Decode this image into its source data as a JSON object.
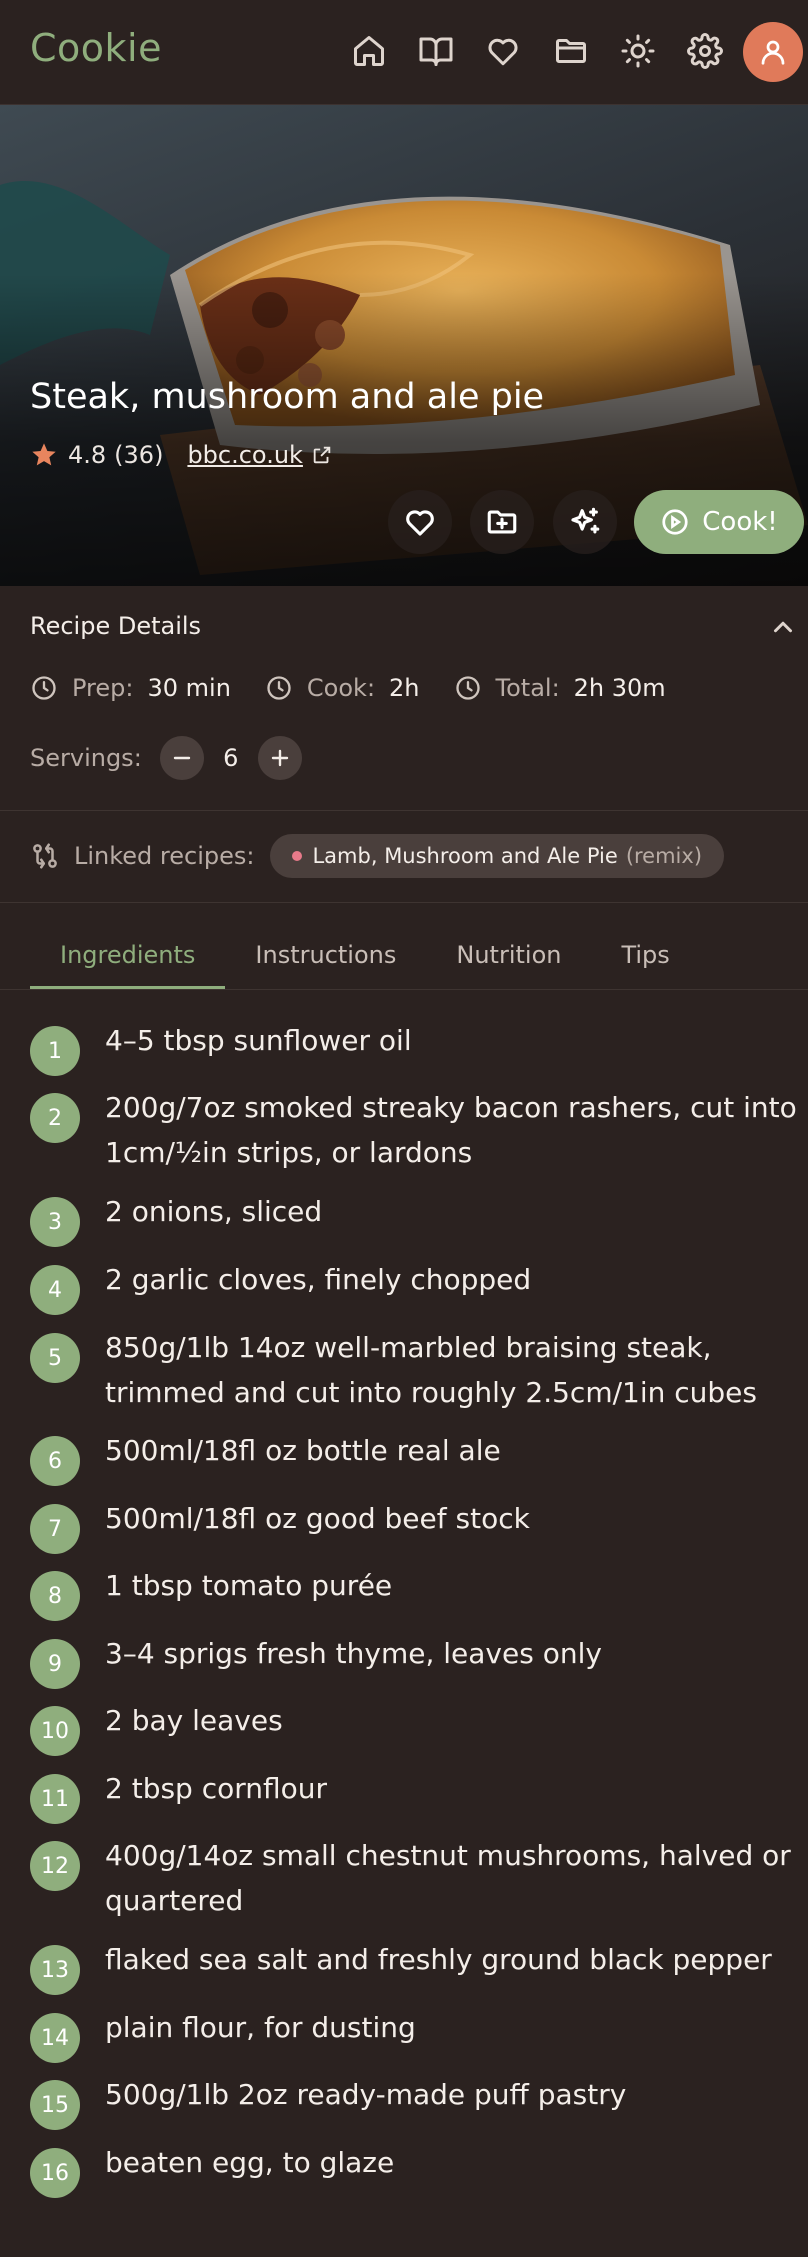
{
  "app": {
    "name": "Cookie"
  },
  "nav": {
    "icons": [
      "home-icon",
      "book-icon",
      "heart-icon",
      "folder-icon",
      "sun-icon",
      "gear-icon"
    ]
  },
  "recipe": {
    "title": "Steak, mushroom and ale pie",
    "rating": "4.8",
    "rating_count": "(36)",
    "source": "bbc.co.uk"
  },
  "actions": {
    "cook_label": "Cook!"
  },
  "details": {
    "title": "Recipe Details",
    "prep_label": "Prep:",
    "prep_value": "30 min",
    "cook_label": "Cook:",
    "cook_value": "2h",
    "total_label": "Total:",
    "total_value": "2h 30m",
    "servings_label": "Servings:",
    "servings_value": "6"
  },
  "linked": {
    "label": "Linked recipes:",
    "chip_name": "Lamb, Mushroom and Ale Pie",
    "chip_tag": "(remix)"
  },
  "tabs": [
    "Ingredients",
    "Instructions",
    "Nutrition",
    "Tips"
  ],
  "active_tab": "Ingredients",
  "ingredients": [
    "4–5 tbsp sunflower oil",
    "200g/7oz smoked streaky bacon rashers, cut into 1cm/½in strips, or lardons",
    "2 onions, sliced",
    "2 garlic cloves, finely chopped",
    "850g/1lb 14oz well-marbled braising steak, trimmed and cut into roughly 2.5cm/1in cubes",
    "500ml/18fl oz bottle real ale",
    "500ml/18fl oz good beef stock",
    "1 tbsp tomato purée",
    "3–4 sprigs fresh thyme, leaves only",
    "2 bay leaves",
    "2 tbsp cornflour",
    "400g/14oz small chestnut mushrooms, halved or quartered",
    "flaked sea salt and freshly ground black pepper",
    "plain flour, for dusting",
    "500g/1lb 2oz ready-made puff pastry",
    "beaten egg, to glaze"
  ],
  "colors": {
    "accent": "#8fae7d",
    "avatar": "#e07a5a",
    "background": "#2b2220",
    "chip_dot": "#e87a8a"
  }
}
